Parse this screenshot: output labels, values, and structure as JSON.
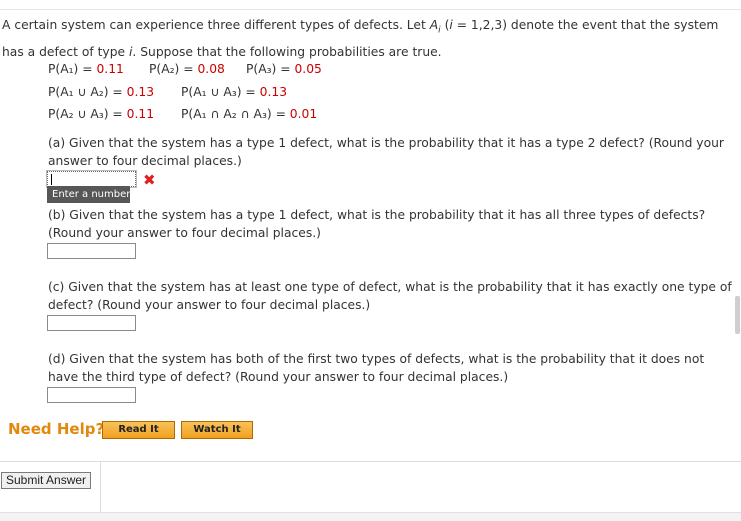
{
  "intro": {
    "text1": "A certain system can experience three different types of defects. Let ",
    "var": "A",
    "sub": "i",
    "text2": " (",
    "ivar": "i",
    "text3": " = 1,2,3) denote the event that the system has a defect of type ",
    "ivar2": "i",
    "text4": ". Suppose that the following probabilities are true."
  },
  "probabilities": {
    "p1": {
      "label": "P(A₁) = ",
      "value": "0.11"
    },
    "p2": {
      "label": "P(A₂) = ",
      "value": "0.08"
    },
    "p3": {
      "label": "P(A₃) = ",
      "value": "0.05"
    },
    "p12": {
      "label": "P(A₁ ∪ A₂) = ",
      "value": "0.13"
    },
    "p13": {
      "label": "P(A₁ ∪ A₃) = ",
      "value": "0.13"
    },
    "p23": {
      "label": "P(A₂ ∪ A₃) = ",
      "value": "0.11"
    },
    "p123": {
      "label": "P(A₁ ∩ A₂ ∩ A₃) = ",
      "value": "0.01"
    }
  },
  "questions": {
    "a": "(a) Given that the system has a type 1 defect, what is the probability that it has a type 2 defect? (Round your answer to four decimal places.)",
    "b": "(b) Given that the system has a type 1 defect, what is the probability that it has all three types of defects? (Round your answer to four decimal places.)",
    "c": "(c) Given that the system has at least one type of defect, what is the probability that it has exactly one type of defect? (Round your answer to four decimal places.)",
    "d": "(d) Given that the system has both of the first two types of defects, what is the probability that it does not have the third type of defect? (Round your answer to four decimal places.)"
  },
  "answers": {
    "a": "",
    "b": "",
    "c": "",
    "d": ""
  },
  "feedback": {
    "mark": "✖",
    "tooltip": "Enter a number."
  },
  "help": {
    "title": "Need Help?",
    "read": "Read It",
    "watch": "Watch It"
  },
  "submit": {
    "label": "Submit Answer"
  },
  "colors": {
    "value_red": "#cc0000",
    "help_orange": "#e3870d",
    "error_red": "#e02020"
  }
}
